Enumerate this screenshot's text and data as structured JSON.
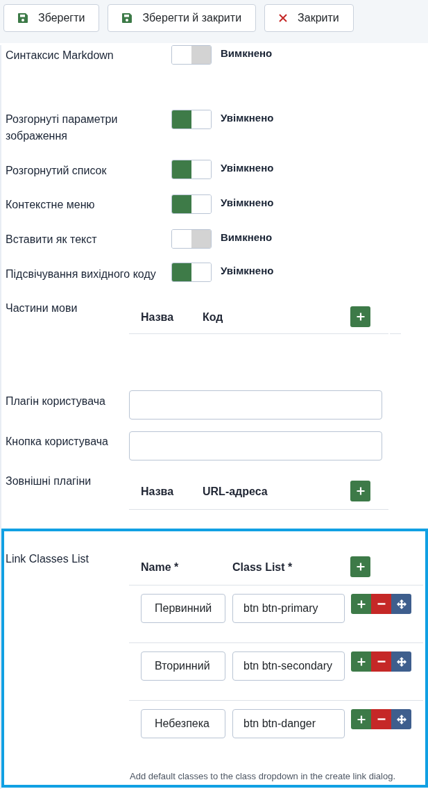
{
  "toolbar": {
    "buttons": [
      {
        "kind": "save",
        "label": "Зберегти"
      },
      {
        "kind": "save",
        "label": "Зберегти й закрити"
      },
      {
        "kind": "close",
        "label": "Закрити"
      }
    ]
  },
  "settings": [
    {
      "kind": "toggle",
      "label": "Синтаксис Markdown",
      "on": false,
      "state_label": "Вимкнено"
    },
    {
      "kind": "toggle",
      "label": "Розгорнуті параметри зображення",
      "on": true,
      "state_label": "Увімкнено"
    },
    {
      "kind": "toggle",
      "label": "Розгорнутий список",
      "on": true,
      "state_label": "Увімкнено"
    },
    {
      "kind": "toggle",
      "label": "Контекстне меню",
      "on": true,
      "state_label": "Увімкнено"
    },
    {
      "kind": "toggle",
      "label": "Вставити як текст",
      "on": false,
      "state_label": "Вимкнено"
    },
    {
      "kind": "toggle",
      "label": "Підсвічування вихідного коду",
      "on": true,
      "state_label": "Увімкнено"
    },
    {
      "kind": "table",
      "label": "Частини мови",
      "columns": [
        "Назва",
        "Код"
      ]
    },
    {
      "kind": "text",
      "label": "Плагін користувача"
    },
    {
      "kind": "text",
      "label": "Кнопка користувача"
    },
    {
      "kind": "table",
      "label": "Зовнішні плагіни",
      "columns": [
        "Назва",
        "URL-адреса"
      ]
    }
  ],
  "link_classes": {
    "label": "Link Classes List",
    "columns": [
      "Name *",
      "Class List *"
    ],
    "rows": [
      {
        "name": "Первинний",
        "class_list": "btn btn-primary"
      },
      {
        "name": "Вторинний",
        "class_list": "btn btn-secondary"
      },
      {
        "name": "Небезпека",
        "class_list": "btn btn-danger"
      }
    ],
    "help": "Add default classes to the class dropdown in the create link dialog."
  }
}
